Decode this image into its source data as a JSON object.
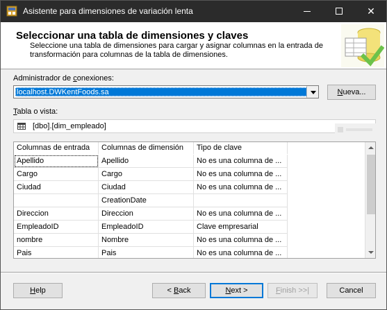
{
  "window": {
    "title": "Asistente para dimensiones de variación lenta",
    "minimize_icon": "minimize-icon",
    "maximize_icon": "maximize-icon",
    "close_glyph": "✕"
  },
  "header": {
    "title": "Seleccionar una tabla de dimensiones y claves",
    "description": "Seleccione una tabla de dimensiones para cargar y asignar columnas en la entrada de transformación para columnas de la tabla de dimensiones."
  },
  "connection": {
    "label_prefix": "Administrador de ",
    "label_underlined": "c",
    "label_suffix": "onexiones:",
    "value": "localhost.DWKentFoods.sa",
    "new_button_label_u": "N",
    "new_button_label_rest": "ueva..."
  },
  "table": {
    "label_underlined": "T",
    "label_rest": "abla o vista:",
    "value": "[dbo].[dim_empleado]"
  },
  "grid": {
    "headers": [
      "Columnas de entrada",
      "Columnas de dimensión",
      "Tipo de clave"
    ],
    "rows": [
      {
        "input": "Apellido",
        "dimension": "Apellido",
        "key": "No es una columna de ..."
      },
      {
        "input": "Cargo",
        "dimension": "Cargo",
        "key": "No es una columna de ..."
      },
      {
        "input": "Ciudad",
        "dimension": "Ciudad",
        "key": "No es una columna de ..."
      },
      {
        "input": "",
        "dimension": "CreationDate",
        "key": ""
      },
      {
        "input": "Direccion",
        "dimension": "Direccion",
        "key": "No es una columna de ..."
      },
      {
        "input": "EmpleadoID",
        "dimension": "EmpleadoID",
        "key": "Clave empresarial"
      },
      {
        "input": "nombre",
        "dimension": "Nombre",
        "key": "No es una columna de ..."
      },
      {
        "input": "Pais",
        "dimension": "Pais",
        "key": "No es una columna de ..."
      }
    ]
  },
  "footer": {
    "help_u": "H",
    "help_rest": "elp",
    "back_prefix": "< ",
    "back_u": "B",
    "back_rest": "ack",
    "next_u": "N",
    "next_rest": "ext >",
    "finish_u": "F",
    "finish_rest": "inish >>|",
    "cancel_label": "Cancel"
  },
  "colors": {
    "titlebar": "#2b2b2b",
    "selection": "#0078d7"
  }
}
